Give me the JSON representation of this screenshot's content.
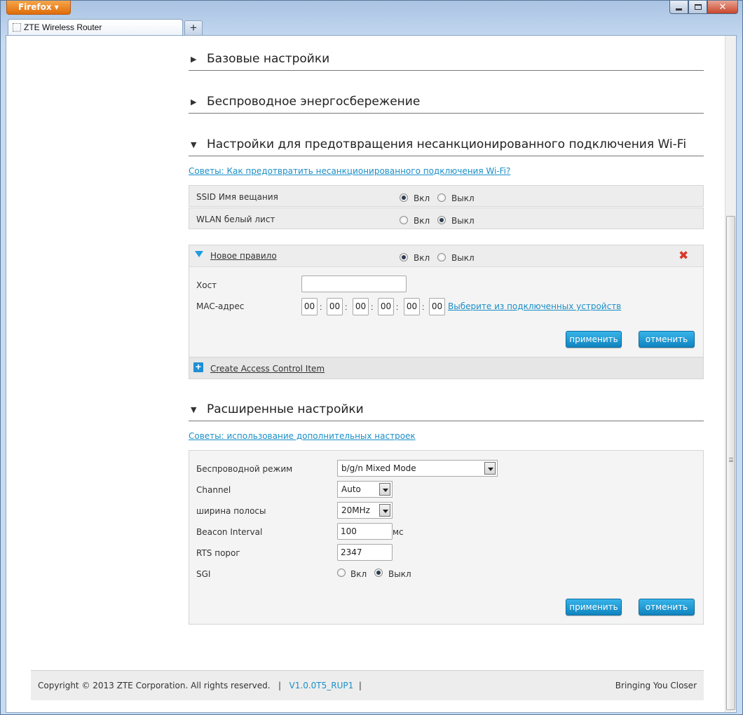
{
  "browser": {
    "menu_button": "Firefox",
    "tab_title": "ZTE Wireless Router",
    "new_tab": "+"
  },
  "sections": {
    "basic": "Базовые настройки",
    "power_saving": "Беспроводное энергосбережение",
    "anti_unauthorized": "Настройки для предотвращения несанкционированного подключения Wi-Fi",
    "advanced": "Расширенные настройки"
  },
  "anti_unauthorized": {
    "tip_link": "Советы: Как предотвратить несанкционированного подключения Wi-Fi?",
    "ssid_broadcast": {
      "label": "SSID Имя вещания",
      "on_label": "Вкл",
      "off_label": "Выкл",
      "selected": "on"
    },
    "wlan_whitelist": {
      "label": "WLAN белый лист",
      "on_label": "Вкл",
      "off_label": "Выкл",
      "selected": "off"
    },
    "new_rule": {
      "title": "Новое правило",
      "on_label": "Вкл",
      "off_label": "Выкл",
      "selected": "on",
      "host_label": "Хост",
      "host_value": "",
      "mac_label": "MAC-адрес",
      "mac_octets": [
        "00",
        "00",
        "00",
        "00",
        "00",
        "00"
      ],
      "mac_separator": ":",
      "select_devices_link": "Выберите из подключенных устройств",
      "apply": "применить",
      "cancel": "отменить"
    },
    "create_item": "Create Access Control Item"
  },
  "advanced": {
    "tip_link": "Советы: использование дополнительных настроек",
    "wireless_mode": {
      "label": "Беспроводной режим",
      "value": "b/g/n Mixed Mode"
    },
    "channel": {
      "label": "Channel",
      "value": "Auto"
    },
    "bandwidth": {
      "label": "ширина полосы",
      "value": "20MHz"
    },
    "beacon_interval": {
      "label": "Beacon Interval",
      "value": "100",
      "unit": "мс"
    },
    "rts_threshold": {
      "label": "RTS порог",
      "value": "2347"
    },
    "sgi": {
      "label": "SGI",
      "on_label": "Вкл",
      "off_label": "Выкл",
      "selected": "off"
    },
    "apply": "применить",
    "cancel": "отменить"
  },
  "footer": {
    "copyright": "Copyright © 2013 ZTE Corporation. All rights reserved.",
    "separator": "|",
    "version": "V1.0.0T5_RUP1",
    "tagline": "Bringing You Closer"
  },
  "colors": {
    "accent": "#1a8fc8",
    "button": "#1f9bd7",
    "delete": "#d9382b",
    "add": "#1e8fd6"
  }
}
